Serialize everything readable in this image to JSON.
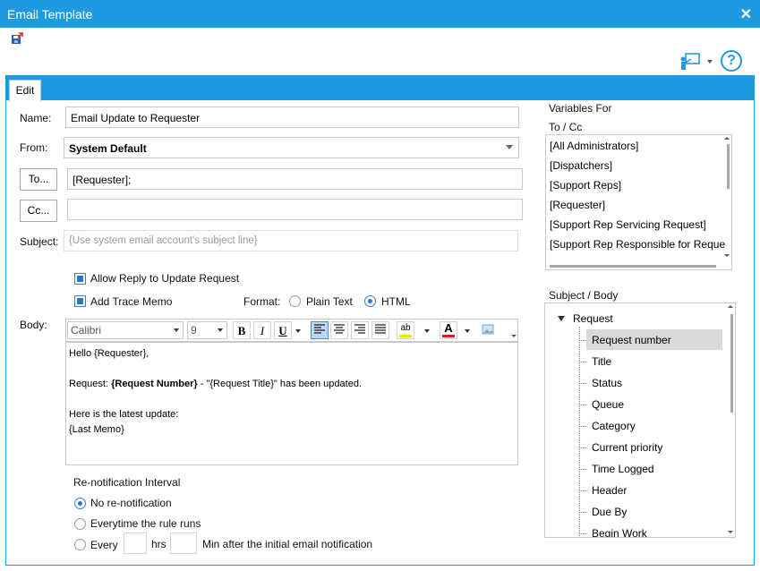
{
  "window": {
    "title": "Email Template",
    "close_symbol": "✕"
  },
  "tabs": [
    {
      "label": "Edit"
    }
  ],
  "form": {
    "name_label": "Name:",
    "name_value": "Email Update to Requester",
    "from_label": "From:",
    "from_value": "System Default",
    "to_button": "To...",
    "to_value": "[Requester];",
    "cc_button": "Cc...",
    "cc_value": "",
    "subject_label": "Subject:",
    "subject_placeholder": "{Use system email account's subject line}",
    "allow_reply_label": "Allow Reply to Update Request",
    "add_trace_label": "Add Trace Memo",
    "format_label": "Format:",
    "format_plain": "Plain Text",
    "format_html": "HTML",
    "format_selected": "HTML",
    "body_label": "Body:"
  },
  "editor_toolbar": {
    "font": "Calibri",
    "size": "9",
    "bold": "B",
    "italic": "I",
    "underline": "U",
    "highlight_glyph": "ab",
    "font_color_glyph": "A",
    "highlight_color": "#f2e600",
    "font_color": "#d81e1e"
  },
  "body_text": {
    "line1": "Hello {Requester},",
    "line2_prefix": "Request: ",
    "line2_bold": "{Request Number}",
    "line2_suffix": " - \"{Request Title}\" has been updated.",
    "line3": "Here is the latest update:",
    "line4": "{Last Memo}"
  },
  "renotification": {
    "header": "Re-notification Interval",
    "options": [
      "No re-notification",
      "Everytime the rule runs",
      "Every"
    ],
    "selected": "No re-notification",
    "hrs_label": "hrs",
    "min_label": "Min after the initial email notification"
  },
  "variables": {
    "header_line1": "Variables For",
    "header_line2": "To / Cc",
    "items": [
      "[All Administrators]",
      "[Dispatchers]",
      "[Support Reps]",
      "[Requester]",
      "[Support Rep Servicing Request]",
      "[Support Rep Responsible for Reque"
    ]
  },
  "subject_body": {
    "header": "Subject / Body",
    "root": "Request",
    "items": [
      "Request number",
      "Title",
      "Status",
      "Queue",
      "Category",
      "Current priority",
      "Time Logged",
      "Header",
      "Due By",
      "Begin Work"
    ],
    "selected": "Request number"
  },
  "colors": {
    "accent": "#1e9ae3",
    "selection": "#dadada"
  }
}
